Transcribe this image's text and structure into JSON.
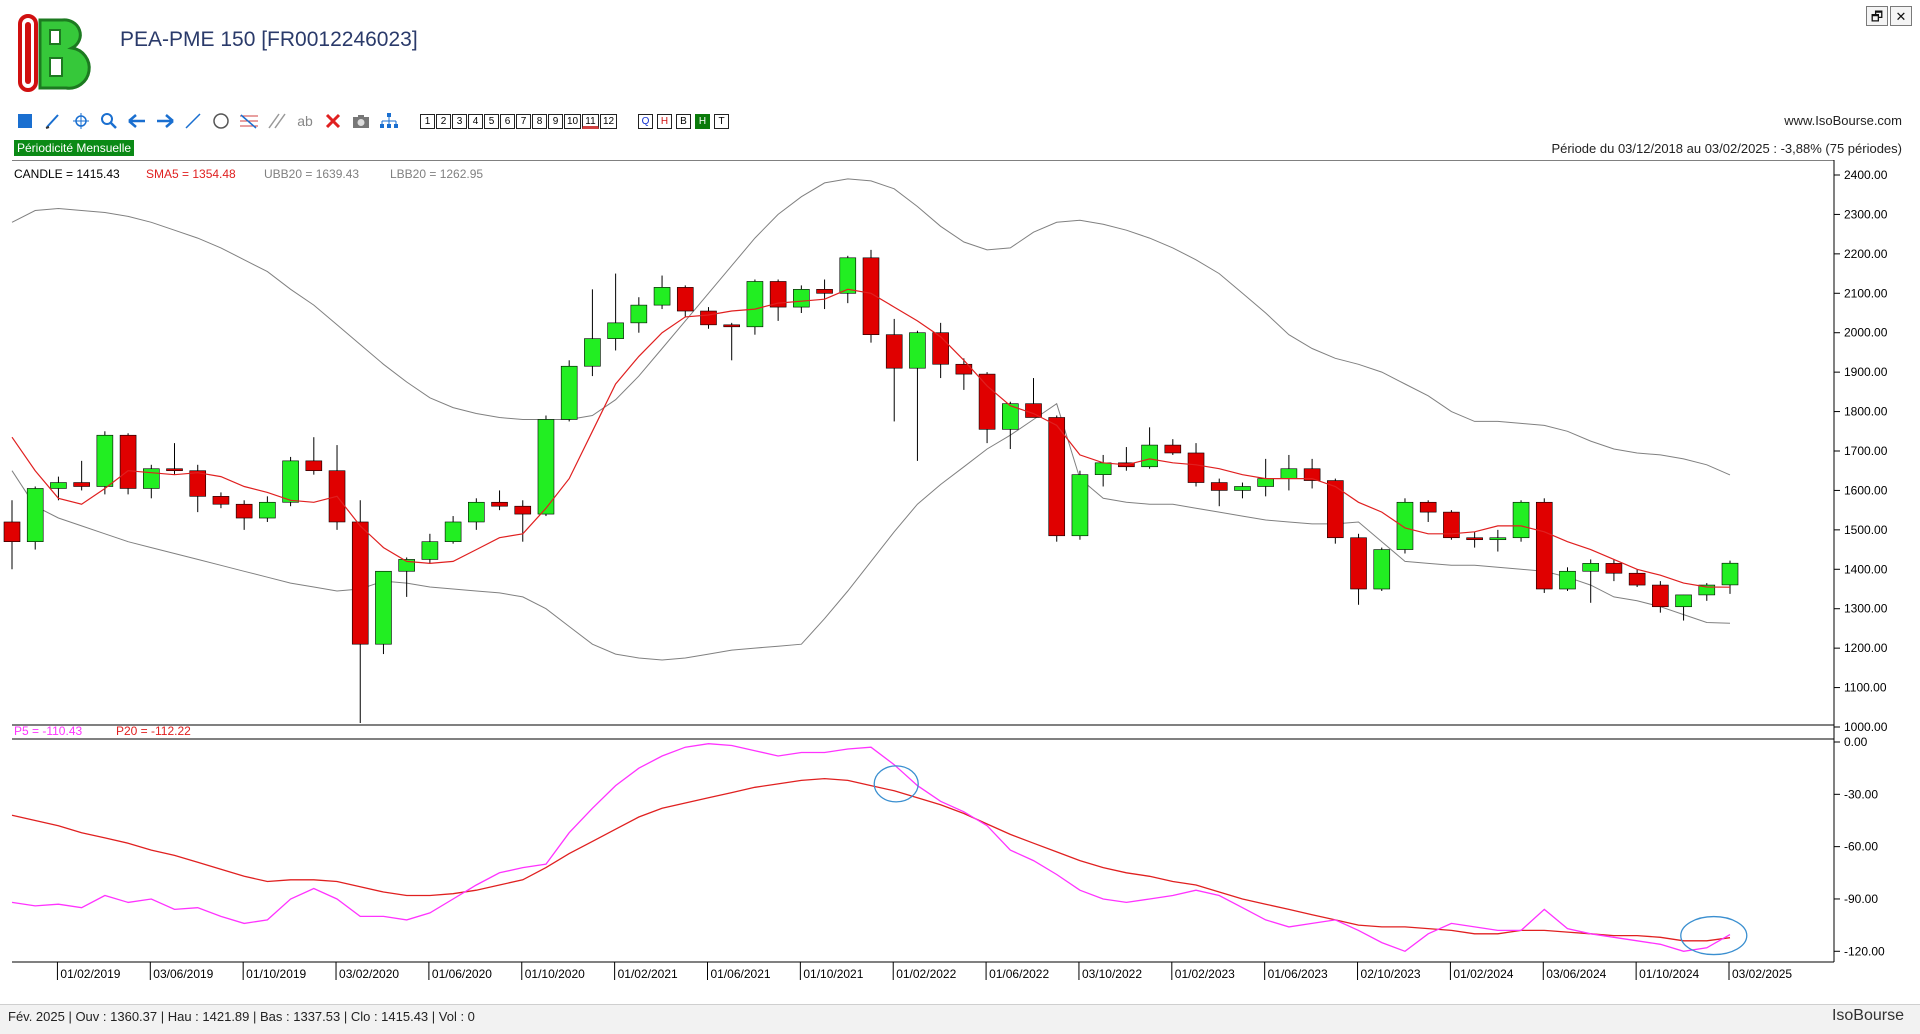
{
  "window": {
    "title": "PEA-PME 150 [FR0012246023]",
    "restore_label": "🗗",
    "close_label": "✕"
  },
  "toolbar": {
    "period_buttons": [
      "1",
      "2",
      "3",
      "4",
      "5",
      "6",
      "7",
      "8",
      "9",
      "10",
      "11",
      "12"
    ],
    "active_period": "11",
    "letter_buttons": [
      "Q",
      "H",
      "B",
      "H",
      "T"
    ],
    "site": "www.IsoBourse.com",
    "draw_text_label": "ab"
  },
  "info": {
    "periodicity": "Périodicité Mensuelle",
    "period_range": "Période du 03/12/2018 au 03/02/2025 : -3,88% (75 périodes)"
  },
  "legend": {
    "candle": "CANDLE = 1415.43",
    "sma": "SMA5 = 1354.48",
    "ubb": "UBB20 = 1639.43",
    "lbb": "LBB20 = 1262.95",
    "p5": "P5 = -110.43",
    "p20": "P20 = -112.22"
  },
  "status": {
    "text": "Fév. 2025 | Ouv : 1360.37 | Hau : 1421.89 | Bas : 1337.53 | Clo : 1415.43 | Vol : 0",
    "brand": "IsoBourse"
  },
  "colors": {
    "up": "#22ee22",
    "down": "#e00000",
    "sma": "#e02020",
    "bands": "#808080",
    "p5": "#ff33ff",
    "p20": "#e02020",
    "marker": "#3a8fd0"
  },
  "chart_data": {
    "type": "candlestick",
    "x_ticks": [
      "01/02/2019",
      "03/06/2019",
      "01/10/2019",
      "03/02/2020",
      "01/06/2020",
      "01/10/2020",
      "01/02/2021",
      "01/06/2021",
      "01/10/2021",
      "01/02/2022",
      "01/06/2022",
      "03/10/2022",
      "01/02/2023",
      "01/06/2023",
      "02/10/2023",
      "01/02/2024",
      "03/06/2024",
      "01/10/2024",
      "03/02/2025"
    ],
    "price_ticks": [
      "2400.00",
      "2300.00",
      "2200.00",
      "2100.00",
      "2000.00",
      "1900.00",
      "1800.00",
      "1700.00",
      "1600.00",
      "1500.00",
      "1400.00",
      "1300.00",
      "1200.00",
      "1100.00",
      "1000.00"
    ],
    "price_ylim": [
      1000,
      2400
    ],
    "osc_ticks": [
      "0.00",
      "-30.00",
      "-60.00",
      "-90.00",
      "-120.00"
    ],
    "osc_ylim": [
      -125,
      0
    ],
    "candles": [
      [
        1520,
        1575,
        1400,
        1470
      ],
      [
        1470,
        1610,
        1450,
        1605
      ],
      [
        1605,
        1635,
        1575,
        1620
      ],
      [
        1620,
        1675,
        1600,
        1610
      ],
      [
        1610,
        1750,
        1590,
        1740
      ],
      [
        1740,
        1745,
        1590,
        1605
      ],
      [
        1605,
        1665,
        1580,
        1655
      ],
      [
        1655,
        1720,
        1640,
        1650
      ],
      [
        1650,
        1665,
        1545,
        1585
      ],
      [
        1585,
        1595,
        1555,
        1565
      ],
      [
        1565,
        1575,
        1500,
        1530
      ],
      [
        1530,
        1585,
        1520,
        1570
      ],
      [
        1570,
        1685,
        1560,
        1675
      ],
      [
        1675,
        1735,
        1640,
        1650
      ],
      [
        1650,
        1715,
        1500,
        1520
      ],
      [
        1520,
        1575,
        1010,
        1210
      ],
      [
        1210,
        1395,
        1185,
        1395
      ],
      [
        1395,
        1430,
        1330,
        1425
      ],
      [
        1425,
        1490,
        1415,
        1470
      ],
      [
        1470,
        1535,
        1465,
        1520
      ],
      [
        1520,
        1580,
        1500,
        1570
      ],
      [
        1570,
        1600,
        1550,
        1560
      ],
      [
        1560,
        1575,
        1470,
        1540
      ],
      [
        1540,
        1790,
        1535,
        1780
      ],
      [
        1780,
        1930,
        1775,
        1915
      ],
      [
        1915,
        2110,
        1890,
        1985
      ],
      [
        1985,
        2150,
        1955,
        2025
      ],
      [
        2025,
        2090,
        2000,
        2070
      ],
      [
        2070,
        2145,
        2060,
        2115
      ],
      [
        2115,
        2120,
        2040,
        2055
      ],
      [
        2055,
        2065,
        2010,
        2020
      ],
      [
        2020,
        2025,
        1930,
        2015
      ],
      [
        2015,
        2135,
        1995,
        2130
      ],
      [
        2130,
        2135,
        2030,
        2065
      ],
      [
        2065,
        2120,
        2050,
        2110
      ],
      [
        2110,
        2135,
        2060,
        2100
      ],
      [
        2100,
        2195,
        2075,
        2190
      ],
      [
        2190,
        2210,
        1975,
        1995
      ],
      [
        1995,
        2035,
        1775,
        1910
      ],
      [
        1910,
        2005,
        1675,
        2000
      ],
      [
        2000,
        2025,
        1885,
        1920
      ],
      [
        1920,
        1935,
        1855,
        1895
      ],
      [
        1895,
        1900,
        1720,
        1755
      ],
      [
        1755,
        1825,
        1705,
        1820
      ],
      [
        1820,
        1885,
        1790,
        1785
      ],
      [
        1785,
        1790,
        1470,
        1485
      ],
      [
        1485,
        1650,
        1475,
        1640
      ],
      [
        1640,
        1690,
        1610,
        1670
      ],
      [
        1670,
        1710,
        1650,
        1660
      ],
      [
        1660,
        1760,
        1655,
        1715
      ],
      [
        1715,
        1730,
        1690,
        1695
      ],
      [
        1695,
        1720,
        1610,
        1620
      ],
      [
        1620,
        1630,
        1560,
        1600
      ],
      [
        1600,
        1620,
        1580,
        1610
      ],
      [
        1610,
        1680,
        1585,
        1630
      ],
      [
        1630,
        1690,
        1600,
        1655
      ],
      [
        1655,
        1680,
        1605,
        1625
      ],
      [
        1625,
        1630,
        1465,
        1480
      ],
      [
        1480,
        1490,
        1310,
        1350
      ],
      [
        1350,
        1455,
        1345,
        1450
      ],
      [
        1450,
        1580,
        1440,
        1570
      ],
      [
        1570,
        1575,
        1520,
        1545
      ],
      [
        1545,
        1550,
        1475,
        1480
      ],
      [
        1480,
        1495,
        1455,
        1475
      ],
      [
        1475,
        1500,
        1445,
        1480
      ],
      [
        1480,
        1575,
        1470,
        1570
      ],
      [
        1570,
        1580,
        1340,
        1350
      ],
      [
        1350,
        1405,
        1345,
        1395
      ],
      [
        1395,
        1425,
        1315,
        1415
      ],
      [
        1415,
        1425,
        1370,
        1390
      ],
      [
        1390,
        1400,
        1355,
        1360
      ],
      [
        1360,
        1370,
        1290,
        1305
      ],
      [
        1305,
        1335,
        1270,
        1335
      ],
      [
        1335,
        1365,
        1320,
        1360
      ],
      [
        1360.37,
        1421.89,
        1337.53,
        1415.43
      ]
    ],
    "sma5": [
      1735,
      1650,
      1580,
      1565,
      1605,
      1650,
      1645,
      1640,
      1645,
      1635,
      1610,
      1595,
      1575,
      1570,
      1585,
      1510,
      1455,
      1420,
      1415,
      1420,
      1450,
      1480,
      1490,
      1555,
      1630,
      1750,
      1870,
      1940,
      2000,
      2040,
      2045,
      2055,
      2060,
      2075,
      2080,
      2085,
      2110,
      2100,
      2065,
      2030,
      1990,
      1930,
      1865,
      1815,
      1795,
      1765,
      1690,
      1670,
      1665,
      1680,
      1670,
      1665,
      1655,
      1640,
      1630,
      1630,
      1630,
      1610,
      1570,
      1545,
      1505,
      1490,
      1490,
      1495,
      1510,
      1510,
      1495,
      1470,
      1450,
      1425,
      1400,
      1385,
      1365,
      1355,
      1354.48
    ],
    "ubb20": [
      2280,
      2310,
      2315,
      2310,
      2305,
      2295,
      2280,
      2260,
      2240,
      2215,
      2185,
      2155,
      2110,
      2070,
      2020,
      1970,
      1920,
      1875,
      1835,
      1810,
      1795,
      1785,
      1780,
      1780,
      1780,
      1790,
      1830,
      1890,
      1960,
      2030,
      2100,
      2170,
      2240,
      2300,
      2345,
      2380,
      2390,
      2385,
      2365,
      2320,
      2270,
      2230,
      2210,
      2215,
      2255,
      2280,
      2285,
      2275,
      2260,
      2240,
      2215,
      2185,
      2150,
      2100,
      2050,
      1995,
      1960,
      1935,
      1920,
      1900,
      1870,
      1840,
      1800,
      1775,
      1775,
      1770,
      1765,
      1750,
      1725,
      1705,
      1695,
      1690,
      1680,
      1665,
      1639.43
    ],
    "lbb20": [
      1650,
      1560,
      1530,
      1510,
      1490,
      1470,
      1455,
      1440,
      1425,
      1410,
      1395,
      1380,
      1365,
      1355,
      1345,
      1350,
      1370,
      1365,
      1355,
      1350,
      1345,
      1340,
      1330,
      1300,
      1255,
      1210,
      1185,
      1175,
      1170,
      1175,
      1185,
      1195,
      1200,
      1205,
      1210,
      1275,
      1345,
      1420,
      1495,
      1565,
      1615,
      1660,
      1705,
      1740,
      1780,
      1820,
      1630,
      1580,
      1570,
      1565,
      1565,
      1555,
      1545,
      1535,
      1525,
      1520,
      1515,
      1515,
      1520,
      1470,
      1420,
      1415,
      1410,
      1410,
      1405,
      1400,
      1395,
      1380,
      1360,
      1330,
      1320,
      1305,
      1285,
      1265,
      1262.95
    ],
    "p5": [
      -92,
      -94,
      -93,
      -95,
      -88,
      -92,
      -90,
      -96,
      -95,
      -100,
      -104,
      -102,
      -90,
      -84,
      -90,
      -100,
      -100,
      -102,
      -98,
      -90,
      -82,
      -75,
      -72,
      -70,
      -52,
      -38,
      -25,
      -15,
      -8,
      -3,
      -1,
      -2,
      -5,
      -8,
      -6,
      -6,
      -4,
      -3,
      -13,
      -25,
      -34,
      -40,
      -48,
      -62,
      -68,
      -76,
      -85,
      -90,
      -92,
      -90,
      -88,
      -85,
      -88,
      -95,
      -102,
      -106,
      -104,
      -102,
      -108,
      -115,
      -120,
      -110,
      -104,
      -106,
      -108,
      -108,
      -96,
      -107,
      -110,
      -112,
      -114,
      -116,
      -120,
      -118,
      -110.43
    ],
    "p20": [
      -42,
      -45,
      -48,
      -52,
      -55,
      -58,
      -62,
      -65,
      -69,
      -73,
      -77,
      -80,
      -79,
      -79,
      -80,
      -83,
      -86,
      -88,
      -88,
      -87,
      -85,
      -82,
      -79,
      -72,
      -64,
      -57,
      -50,
      -43,
      -38,
      -35,
      -32,
      -29,
      -26,
      -24,
      -22,
      -21,
      -22,
      -25,
      -28,
      -32,
      -36,
      -41,
      -47,
      -53,
      -58,
      -63,
      -68,
      -72,
      -75,
      -77,
      -80,
      -82,
      -86,
      -90,
      -93,
      -96,
      -99,
      -102,
      -105,
      -106,
      -106,
      -107,
      -108,
      -110,
      -110,
      -108,
      -108,
      -109,
      -110,
      -111,
      -111,
      -112,
      -114,
      -114,
      -112.22
    ]
  }
}
